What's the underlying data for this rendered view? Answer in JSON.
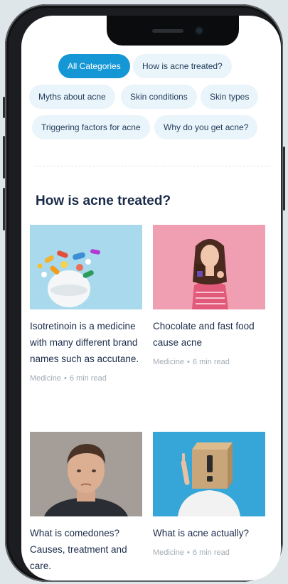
{
  "categories": [
    {
      "label": "All Categories",
      "active": true
    },
    {
      "label": "How is acne treated?",
      "active": false
    },
    {
      "label": "Myths about acne",
      "active": false
    },
    {
      "label": "Skin conditions",
      "active": false
    },
    {
      "label": "Skin types",
      "active": false
    },
    {
      "label": "Triggering factors for acne",
      "active": false
    },
    {
      "label": "Why do you get acne?",
      "active": false
    }
  ],
  "section": {
    "title": "How is acne treated?"
  },
  "articles": [
    {
      "title": "Isotretinoin is a medicine with many different brand names such as accutane.",
      "category": "Medicine",
      "separator": "•",
      "read_time": "6 min read",
      "image": "pills-photo"
    },
    {
      "title": "Chocolate and fast food cause acne",
      "category": "Medicine",
      "separator": "•",
      "read_time": "6 min read",
      "image": "woman-chocolate-photo"
    },
    {
      "title": "What is comedones? Causes, treatment and care.",
      "category": "",
      "separator": "",
      "read_time": "",
      "image": "young-man-photo"
    },
    {
      "title": "What is acne actually?",
      "category": "Medicine",
      "separator": "•",
      "read_time": "6 min read",
      "image": "box-head-photo"
    }
  ],
  "colors": {
    "accent": "#1597d5",
    "chip_bg": "#eaf4fb",
    "title": "#1a2b49",
    "muted": "#a3acb6"
  }
}
